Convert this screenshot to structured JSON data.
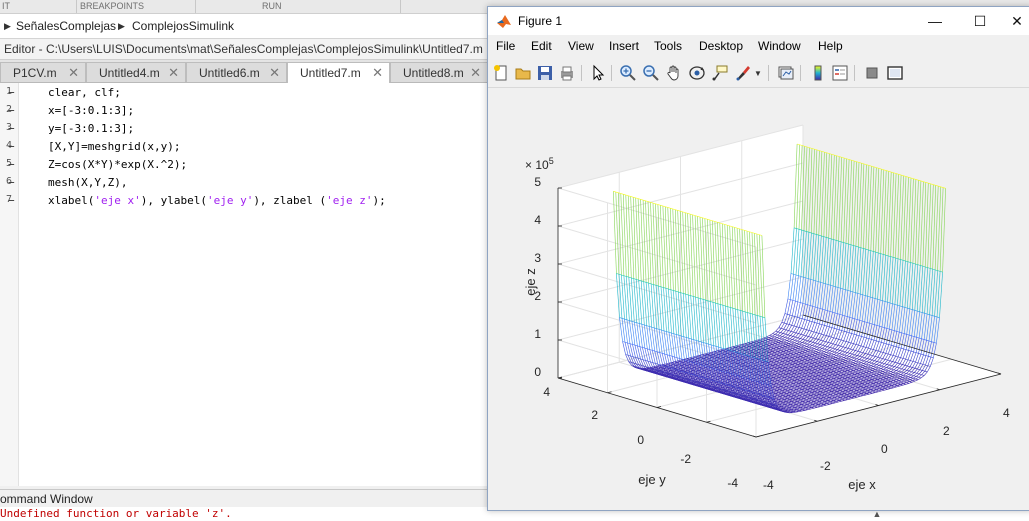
{
  "matlab": {
    "ribbon": {
      "sections": [
        "IT",
        "BREAKPOINTS",
        "RUN"
      ]
    },
    "address_bar": {
      "crumbs": [
        "SeñalesComplejas",
        "ComplejosSimulink"
      ]
    },
    "editor_title": "Editor - C:\\Users\\LUIS\\Documents\\mat\\SeñalesComplejas\\ComplejosSimulink\\Untitled7.m",
    "tabs": [
      {
        "label": "P1CV.m",
        "close": "✕",
        "active": false
      },
      {
        "label": "Untitled4.m",
        "close": "✕",
        "active": false
      },
      {
        "label": "Untitled6.m",
        "close": "✕",
        "active": false
      },
      {
        "label": "Untitled7.m",
        "close": "✕",
        "active": true
      },
      {
        "label": "Untitled8.m",
        "close": "✕",
        "active": false
      }
    ],
    "code": {
      "line_numbers": [
        "1",
        "2",
        "3",
        "4",
        "5",
        "6",
        "7"
      ],
      "lines": [
        "clear, clf;",
        "x=[-3:0.1:3];",
        "y=[-3:0.1:3];",
        "[X,Y]=meshgrid(x,y);",
        "Z=cos(X*Y)*exp(X.^2);",
        "mesh(X,Y,Z),",
        {
          "pre": "xlabel(",
          "s1": "'eje x'",
          "m1": "), ylabel(",
          "s2": "'eje y'",
          "m2": "), zlabel (",
          "s3": "'eje z'",
          "post": ");"
        }
      ]
    },
    "command_window": {
      "title": "ommand Window",
      "error": "Undefined function or variable 'z'."
    }
  },
  "figure": {
    "title": "Figure 1",
    "window_controls": {
      "minimize": "—",
      "maximize": "☐",
      "close": "✕"
    },
    "menu": [
      "File",
      "Edit",
      "View",
      "Insert",
      "Tools",
      "Desktop",
      "Window",
      "Help"
    ],
    "toolbar_icons": [
      "new-figure-icon",
      "open-file-icon",
      "save-icon",
      "print-icon",
      "select-arrow-icon",
      "zoom-in-icon",
      "zoom-out-icon",
      "pan-hand-icon",
      "rotate-3d-icon",
      "data-cursor-icon",
      "brush-icon",
      "link-plot-icon",
      "colorbar-icon",
      "legend-icon",
      "hide-plot-tools-icon",
      "show-plot-tools-icon"
    ]
  },
  "chart_data": {
    "type": "surface-mesh",
    "title": "",
    "xlabel": "eje x",
    "ylabel": "eje y",
    "zlabel": "eje z",
    "xlim": [
      -4,
      4
    ],
    "ylim": [
      -4,
      4
    ],
    "zlim": [
      0,
      5
    ],
    "z_exponent_label": "× 10",
    "z_exponent_power": "5",
    "x_ticks": [
      "-4",
      "-2",
      "0",
      "2",
      "4"
    ],
    "y_ticks": [
      "-4",
      "-2",
      "0",
      "2",
      "4"
    ],
    "z_ticks": [
      "0",
      "1",
      "2",
      "3",
      "4",
      "5"
    ],
    "grid": true,
    "colormap": [
      "#3e26a8",
      "#4274fe",
      "#1fb3d3",
      "#1fcfa4",
      "#91d64a",
      "#f9fb15"
    ],
    "surface": "Z = exp(x^2) rising walls at x = ±3, value ≈ 8.1e3×? approx peak 4.9e5 at edges, flat ~0 in middle"
  }
}
